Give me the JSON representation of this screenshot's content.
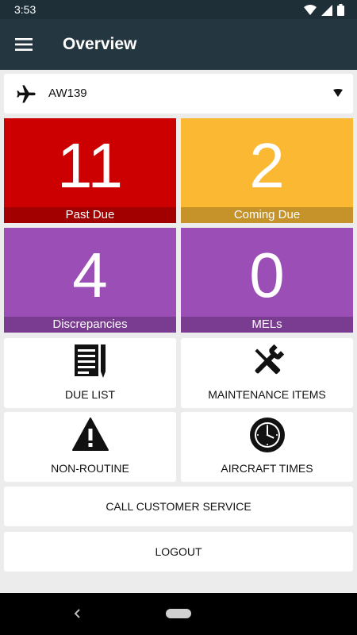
{
  "status_bar": {
    "time": "3:53",
    "icons": [
      "wifi-icon",
      "cell-signal-icon",
      "battery-icon"
    ]
  },
  "app_bar": {
    "title": "Overview",
    "menu_icon": "hamburger-menu-icon"
  },
  "aircraft_selector": {
    "value": "AW139",
    "icon": "airplane-icon",
    "dropdown_icon": "caret-down-icon"
  },
  "summary_tiles": [
    {
      "count": "11",
      "label": "Past Due",
      "color": "#cc0000"
    },
    {
      "count": "2",
      "label": "Coming Due",
      "color": "#fbb833"
    },
    {
      "count": "4",
      "label": "Discrepancies",
      "color": "#9b4eb5"
    },
    {
      "count": "0",
      "label": "MELs",
      "color": "#9b4eb5"
    }
  ],
  "menu_cards": [
    {
      "label": "DUE LIST",
      "icon": "checklist-icon"
    },
    {
      "label": "MAINTENANCE ITEMS",
      "icon": "tools-icon"
    },
    {
      "label": "NON-ROUTINE",
      "icon": "warning-icon"
    },
    {
      "label": "AIRCRAFT TIMES",
      "icon": "clock-icon"
    }
  ],
  "actions": {
    "call_customer_service": "CALL CUSTOMER SERVICE",
    "logout": "LOGOUT"
  },
  "nav_bar": {
    "back_icon": "back-chevron-icon",
    "home_icon": "home-pill-icon"
  }
}
